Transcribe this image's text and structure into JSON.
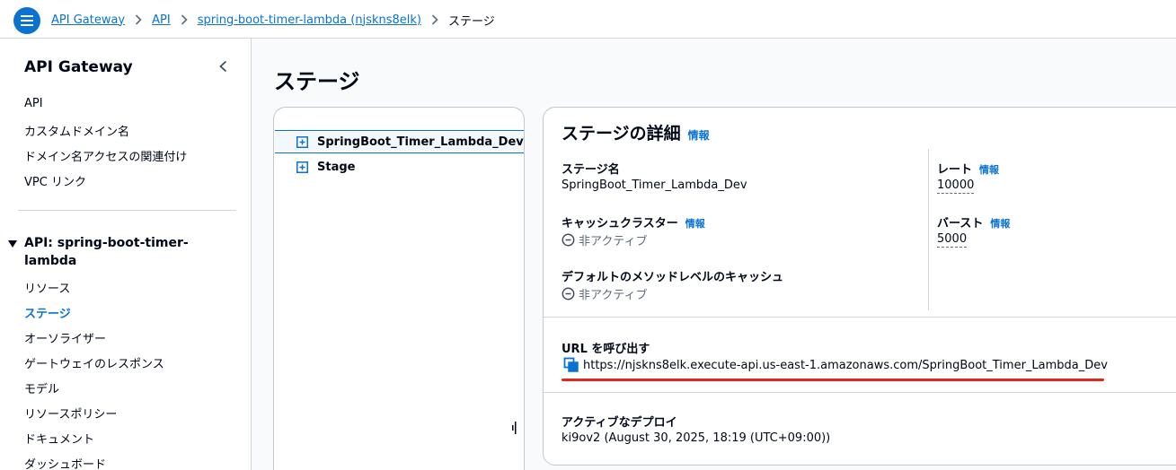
{
  "breadcrumb": {
    "items": [
      "API Gateway",
      "API",
      "spring-boot-timer-lambda (njskns8elk)"
    ],
    "current": "ステージ"
  },
  "sidebar": {
    "title": "API Gateway",
    "top_items": [
      "API",
      "カスタムドメイン名",
      "ドメイン名アクセスの関連付け",
      "VPC リンク"
    ],
    "section_title": "API: spring-boot-timer-lambda",
    "section_items": [
      "リソース",
      "ステージ",
      "オーソライザー",
      "ゲートウェイのレスポンス",
      "モデル",
      "リソースポリシー",
      "ドキュメント",
      "ダッシュボード"
    ],
    "active_item": "ステージ"
  },
  "page": {
    "title": "ステージ"
  },
  "tree": {
    "items": [
      "SpringBoot_Timer_Lambda_Dev",
      "Stage"
    ],
    "selected": "SpringBoot_Timer_Lambda_Dev"
  },
  "details": {
    "title": "ステージの詳細",
    "info": "情報",
    "stage_name_label": "ステージ名",
    "stage_name_value": "SpringBoot_Timer_Lambda_Dev",
    "cache_cluster_label": "キャッシュクラスター",
    "cache_cluster_value": "非アクティブ",
    "default_cache_label": "デフォルトのメソッドレベルのキャッシュ",
    "default_cache_value": "非アクティブ",
    "rate_label": "レート",
    "rate_value": "10000",
    "burst_label": "バースト",
    "burst_value": "5000",
    "invoke_url_label": "URL を呼び出す",
    "invoke_url_value": "https://njskns8elk.execute-api.us-east-1.amazonaws.com/SpringBoot_Timer_Lambda_Dev",
    "active_deploy_label": "アクティブなデプロイ",
    "active_deploy_value": "ki9ov2 (August 30, 2025, 18:19 (UTC+09:00))"
  },
  "colors": {
    "accent": "#0972d3",
    "annotation": "#e8231a",
    "text": "#000716",
    "muted": "#5f6b7a"
  },
  "icons": [
    "menu-icon",
    "chevron-right-icon",
    "chevron-left-icon",
    "caret-down-icon",
    "expand-plus-icon",
    "inactive-status-icon",
    "copy-icon",
    "resize-handle-icon"
  ]
}
